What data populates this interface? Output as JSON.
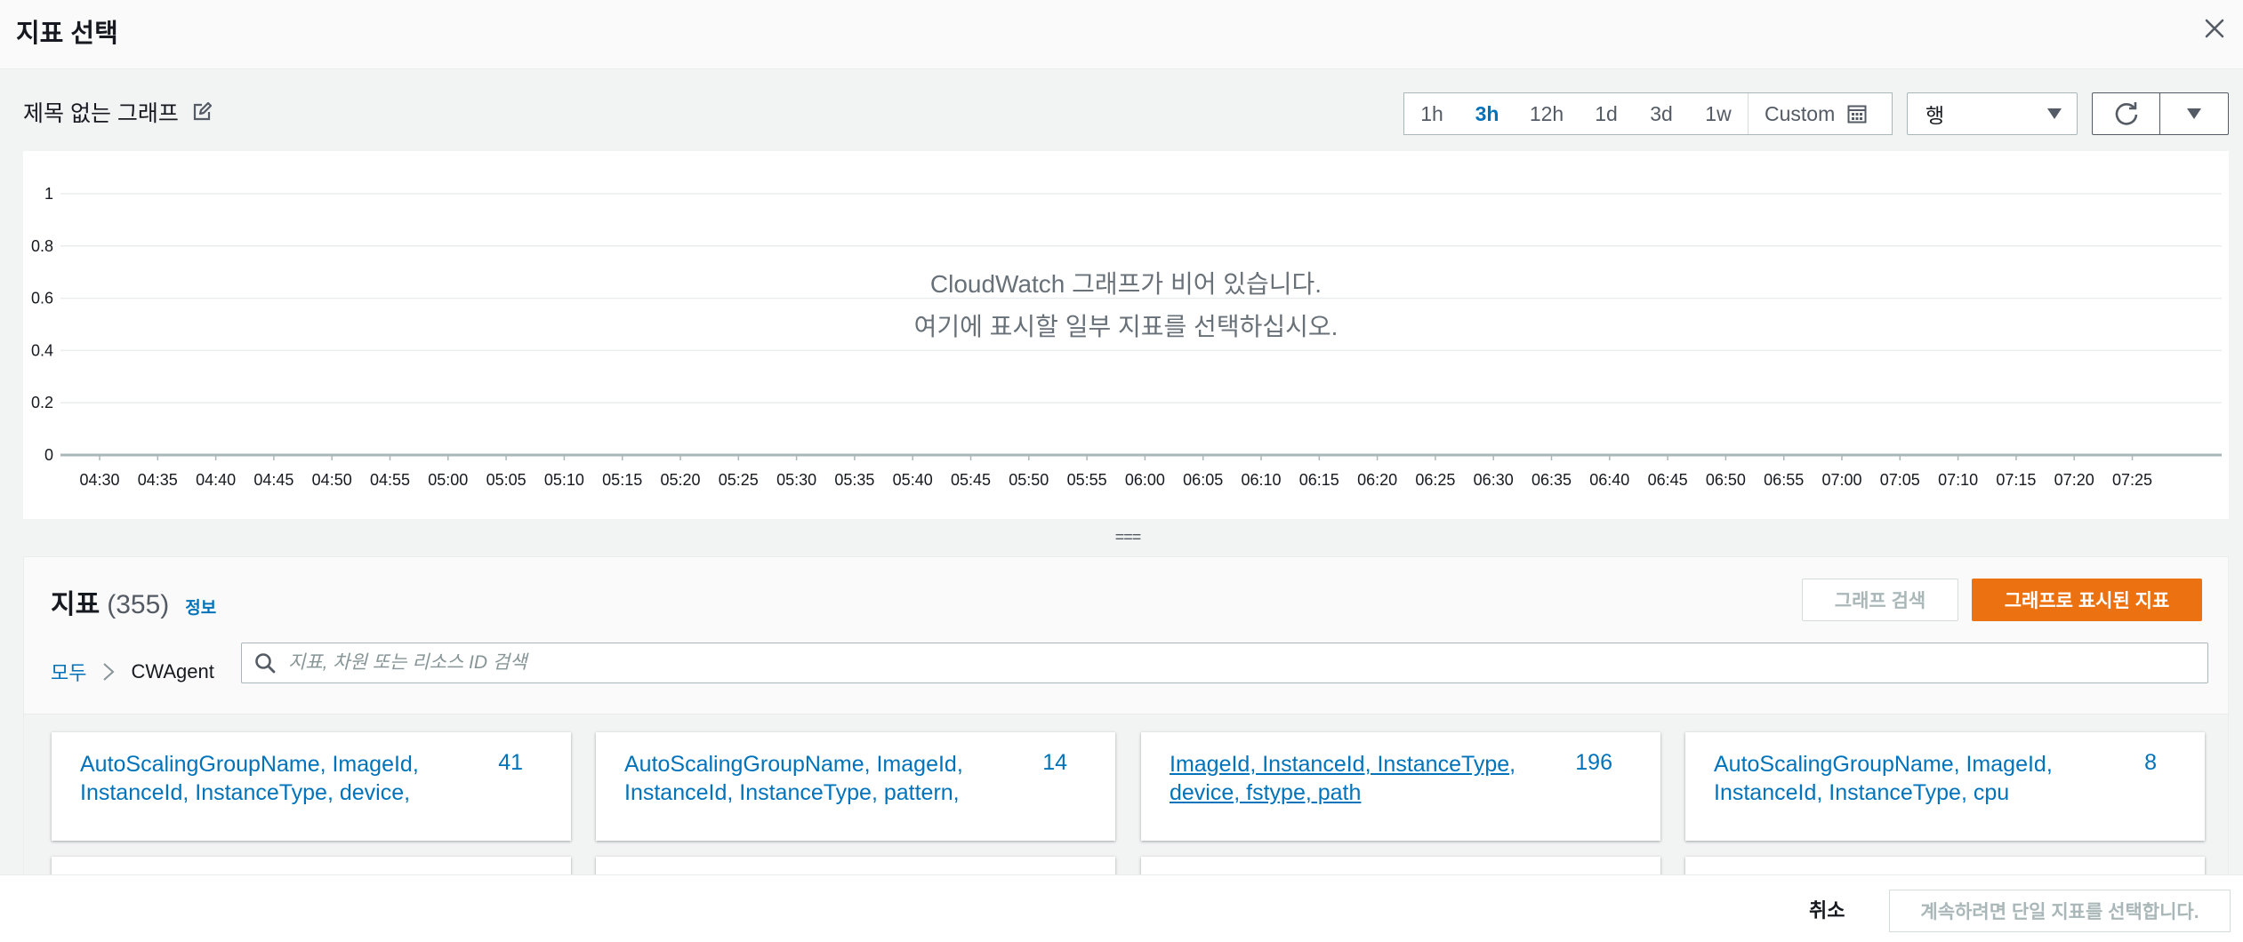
{
  "modal": {
    "title": "지표 선택"
  },
  "graph": {
    "title": "제목 없는 그래프",
    "time_ranges": [
      "1h",
      "3h",
      "12h",
      "1d",
      "3d",
      "1w"
    ],
    "active_time_range": "3h",
    "custom_label": "Custom",
    "view_select_value": "행",
    "empty_line1": "CloudWatch 그래프가 비어 있습니다.",
    "empty_line2": "여기에 표시할 일부 지표를 선택하십시오.",
    "resize_handle": "==="
  },
  "chart_data": {
    "type": "line",
    "title": "",
    "xlabel": "",
    "ylabel": "",
    "ylim": [
      0,
      1
    ],
    "y_ticks": [
      "1",
      "0.8",
      "0.6",
      "0.4",
      "0.2",
      "0"
    ],
    "x": [
      "04:30",
      "04:35",
      "04:40",
      "04:45",
      "04:50",
      "04:55",
      "05:00",
      "05:05",
      "05:10",
      "05:15",
      "05:20",
      "05:25",
      "05:30",
      "05:35",
      "05:40",
      "05:45",
      "05:50",
      "05:55",
      "06:00",
      "06:05",
      "06:10",
      "06:15",
      "06:20",
      "06:25",
      "06:30",
      "06:35",
      "06:40",
      "06:45",
      "06:50",
      "06:55",
      "07:00",
      "07:05",
      "07:10",
      "07:15",
      "07:20",
      "07:25"
    ],
    "series": [],
    "grid": true,
    "grid_color": "#eaeded",
    "axis_color": "#aab7b8"
  },
  "metrics": {
    "title": "지표",
    "count": "(355)",
    "info_link": "정보",
    "graph_search_button": "그래프 검색",
    "graphed_metrics_button": "그래프로 표시된 지표",
    "breadcrumb": {
      "root": "모두",
      "current": "CWAgent"
    },
    "search_placeholder": "지표, 차원 또는 리소스 ID 검색",
    "cards": [
      {
        "label": "AutoScalingGroupName, ImageId, InstanceId, InstanceType, device,",
        "count": "41"
      },
      {
        "label": "AutoScalingGroupName, ImageId, InstanceId, InstanceType, pattern,",
        "count": "14"
      },
      {
        "label": "ImageId, InstanceId, InstanceType, device, fstype, path",
        "count": "196"
      },
      {
        "label": "AutoScalingGroupName, ImageId, InstanceId, InstanceType, cpu",
        "count": "8"
      }
    ]
  },
  "footer": {
    "cancel": "취소",
    "continue": "계속하려면 단일 지표를 선택합니다."
  },
  "colors": {
    "accent_link": "#0073bb",
    "primary_button": "#ec7211",
    "disabled_text": "#aab7b8"
  },
  "icons": {
    "close": "close-icon",
    "edit": "edit-icon",
    "calendar": "calendar-icon",
    "dropdown": "caret-down-icon",
    "refresh": "refresh-icon",
    "search": "search-icon",
    "breadcrumb_separator": "chevron-right-icon"
  }
}
